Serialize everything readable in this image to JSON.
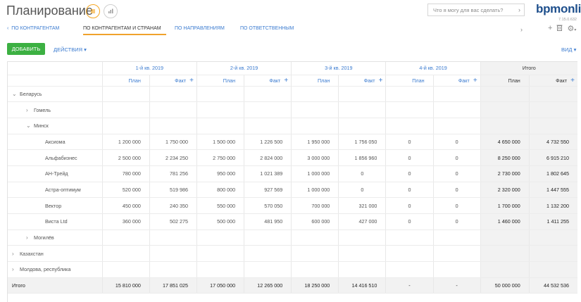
{
  "header": {
    "title": "Планирование",
    "search_placeholder": "Что я могу для вас сделать?",
    "brand": "bpmonline",
    "version": "7.15.0.632"
  },
  "tabs": {
    "back_label": "ПО КОНТРАГЕНТАМ",
    "items": [
      {
        "label": "ПО КОНТРАГЕНТАМ И СТРАНАМ",
        "active": true
      },
      {
        "label": "ПО НАПРАВЛЕНИЯМ",
        "active": false
      },
      {
        "label": "ПО ОТВЕТСТВЕННЫМ",
        "active": false
      }
    ]
  },
  "toolbar": {
    "add_label": "ДОБАВИТЬ",
    "actions_label": "ДЕЙСТВИЯ",
    "view_label": "ВИД"
  },
  "icons": {
    "list_view": "list-icon",
    "chart_view": "chart-icon",
    "search_arrow": "chevron-right-icon",
    "add": "plus-icon",
    "delete": "trash-icon",
    "settings": "gear-icon"
  },
  "colors": {
    "accent": "#f5a623",
    "link": "#3b7bd0",
    "add_button": "#3cb042",
    "brand": "#1e4f8c",
    "total_bg": "#f2f2f2"
  },
  "grid": {
    "periods": [
      "1-й кв. 2019",
      "2-й кв. 2019",
      "3-й кв. 2019",
      "4-й кв. 2019",
      "Итого"
    ],
    "plan_label": "План",
    "fact_label": "Факт",
    "rows": [
      {
        "label": "Беларусь",
        "level": 1,
        "expander": "⌄",
        "values": [
          "",
          "",
          "",
          "",
          "",
          "",
          "",
          "",
          "",
          ""
        ]
      },
      {
        "label": "Гомель",
        "level": 2,
        "expander": "›",
        "values": [
          "",
          "",
          "",
          "",
          "",
          "",
          "",
          "",
          "",
          ""
        ]
      },
      {
        "label": "Минск",
        "level": 2,
        "expander": "⌄",
        "values": [
          "",
          "",
          "",
          "",
          "",
          "",
          "",
          "",
          "",
          ""
        ]
      },
      {
        "label": "Аксиома",
        "level": 3,
        "expander": "",
        "values": [
          "1 200 000",
          "1 750 000",
          "1 500 000",
          "1 226 500",
          "1 950 000",
          "1 756 050",
          "0",
          "0",
          "4 650 000",
          "4 732 550"
        ]
      },
      {
        "label": "Альфабизнес",
        "level": 3,
        "expander": "",
        "values": [
          "2 500 000",
          "2 234 250",
          "2 750 000",
          "2 824 000",
          "3 000 000",
          "1 856 960",
          "0",
          "0",
          "8 250 000",
          "6 915 210"
        ]
      },
      {
        "label": "АН-Трейд",
        "level": 3,
        "expander": "",
        "values": [
          "780 000",
          "781 256",
          "950 000",
          "1 021 389",
          "1 000 000",
          "0",
          "0",
          "0",
          "2 730 000",
          "1 802 645"
        ]
      },
      {
        "label": "Астра-оптимум",
        "level": 3,
        "expander": "",
        "values": [
          "520 000",
          "519 986",
          "800 000",
          "927 569",
          "1 000 000",
          "0",
          "0",
          "0",
          "2 320 000",
          "1 447 555"
        ]
      },
      {
        "label": "Вектор",
        "level": 3,
        "expander": "",
        "values": [
          "450 000",
          "240 350",
          "550 000",
          "570 050",
          "700 000",
          "321 000",
          "0",
          "0",
          "1 700 000",
          "1 132 200"
        ]
      },
      {
        "label": "Виста Ltd",
        "level": 3,
        "expander": "",
        "values": [
          "360 000",
          "502 275",
          "500 000",
          "481 950",
          "600 000",
          "427 000",
          "0",
          "0",
          "1 460 000",
          "1 411 255"
        ]
      },
      {
        "label": "Могилёв",
        "level": 2,
        "expander": "›",
        "values": [
          "",
          "",
          "",
          "",
          "",
          "",
          "",
          "",
          "",
          ""
        ]
      },
      {
        "label": "Казахстан",
        "level": 1,
        "expander": "›",
        "values": [
          "",
          "",
          "",
          "",
          "",
          "",
          "",
          "",
          "",
          ""
        ]
      },
      {
        "label": "Молдова, республика",
        "level": 1,
        "expander": "›",
        "values": [
          "",
          "",
          "",
          "",
          "",
          "",
          "",
          "",
          "",
          ""
        ]
      }
    ],
    "grand_total": {
      "label": "Итого",
      "values": [
        "15 810 000",
        "17 851 025",
        "17 050 000",
        "12 265 000",
        "18 250 000",
        "14 416 510",
        "-",
        "-",
        "50 000 000",
        "44 532 536"
      ]
    }
  }
}
